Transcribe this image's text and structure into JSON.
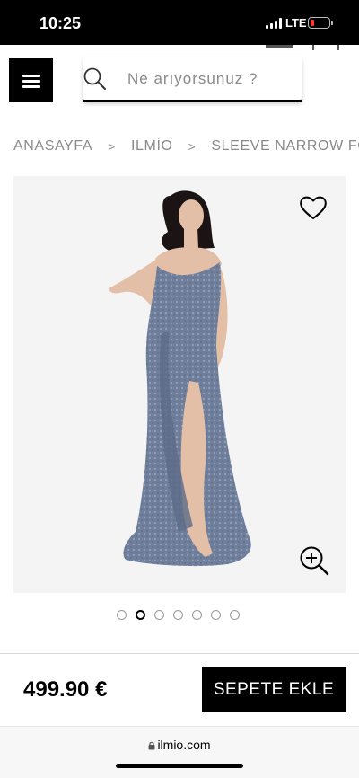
{
  "status_bar": {
    "time": "10:25",
    "network": "LTE",
    "battery_color": "#ff3b30"
  },
  "header": {
    "menu_icon": "hamburger-menu-icon",
    "search": {
      "placeholder": "Ne arıyorsunuz ?",
      "value": "",
      "icon": "search-icon"
    }
  },
  "breadcrumb": {
    "items": [
      "ANASAYFA",
      "ILMİO",
      "SLEEVE NARROW FORM BRO"
    ],
    "separator": ">"
  },
  "product": {
    "image_alt": "model wearing a strapless blue sequined gown with a high slit",
    "dress_color": "#6f7f9c",
    "wishlist_icon": "heart-outline-icon",
    "zoom_icon": "zoom-in-icon",
    "carousel": {
      "count": 7,
      "active_index": 1
    }
  },
  "purchase": {
    "price": "499.90 €",
    "add_to_cart_label": "SEPETE EKLE"
  },
  "browser": {
    "url": "ilmio.com",
    "lock_icon": "lock-icon"
  }
}
